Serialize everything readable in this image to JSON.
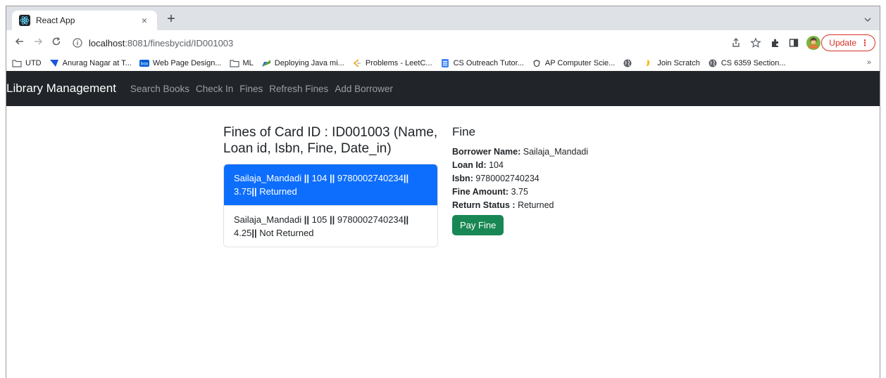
{
  "browser": {
    "tab": {
      "title": "React App",
      "close": "×"
    },
    "new_tab": "+",
    "url_host": "localhost",
    "url_path": ":8081/finesbycid/ID001003",
    "update_label": "Update",
    "update_menu": "⋮",
    "bookmarks": [
      {
        "label": "UTD",
        "icon": "folder-icon"
      },
      {
        "label": "Anurag Nagar at T...",
        "icon": "flag-icon"
      },
      {
        "label": "Web Page Design...",
        "icon": "box-icon"
      },
      {
        "label": "ML",
        "icon": "folder-icon"
      },
      {
        "label": "Deploying Java mi...",
        "icon": "leaf-icon"
      },
      {
        "label": "Problems - LeetC...",
        "icon": "leetcode-icon"
      },
      {
        "label": "CS Outreach Tutor...",
        "icon": "doc-icon"
      },
      {
        "label": "AP Computer Scie...",
        "icon": "acorn-icon"
      },
      {
        "label": "",
        "icon": "globe-icon"
      },
      {
        "label": "Join Scratch",
        "icon": "scratch-icon"
      },
      {
        "label": "CS 6359 Section...",
        "icon": "globe-icon"
      }
    ],
    "bookmarks_more": "»"
  },
  "navbar": {
    "brand": "Library Management",
    "links": [
      "Search Books",
      "Check In",
      "Fines",
      "Refresh Fines",
      "Add Borrower"
    ]
  },
  "fines_list": {
    "title": "Fines of Card ID : ID001003 (Name, Loan id, Isbn, Fine, Date_in)",
    "items": [
      {
        "name": "Sailaja_Mandadi",
        "loan_id": "104",
        "isbn": "9780002740234",
        "fine": "3.75",
        "status": "Returned"
      },
      {
        "name": "Sailaja_Mandadi",
        "loan_id": "105",
        "isbn": "9780002740234",
        "fine": "4.25",
        "status": "Not Returned"
      }
    ],
    "separator": "||"
  },
  "fine_detail": {
    "title": "Fine",
    "borrower_label": "Borrower Name:",
    "borrower_value": "Sailaja_Mandadi",
    "loan_label": "Loan Id:",
    "loan_value": "104",
    "isbn_label": "Isbn:",
    "isbn_value": "9780002740234",
    "amount_label": "Fine Amount:",
    "amount_value": "3.75",
    "status_label": "Return Status :",
    "status_value": "Returned",
    "pay_button": "Pay Fine"
  },
  "colors": {
    "navbar_bg": "#212529",
    "active_item": "#0d6efd",
    "pay_button": "#198754",
    "update_button": "#d93025"
  }
}
